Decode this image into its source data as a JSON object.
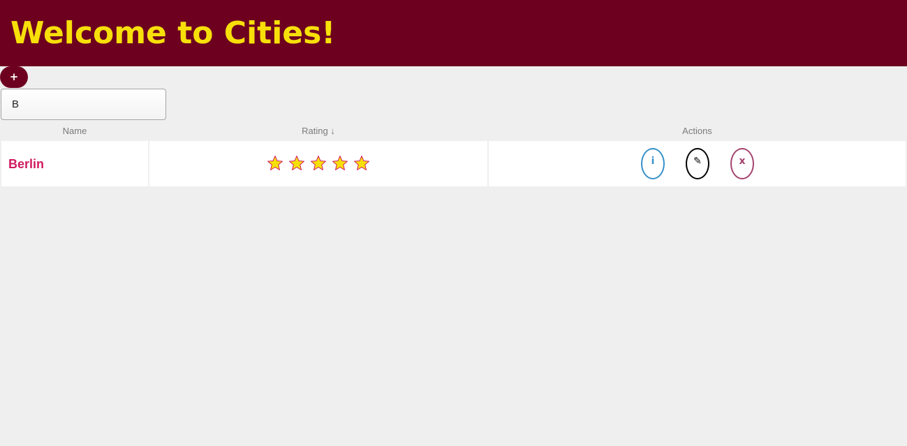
{
  "header": {
    "title": "Welcome to Cities!"
  },
  "toolbar": {
    "add_label": "+"
  },
  "search": {
    "value": "B",
    "placeholder": ""
  },
  "table": {
    "columns": [
      "Name",
      "Rating ↓",
      "Actions"
    ],
    "rows": [
      {
        "name": "Berlin",
        "rating": 5,
        "rating_max": 5,
        "actions": {
          "info_label": "i",
          "edit_label": "✎",
          "delete_label": "x"
        }
      }
    ]
  },
  "colors": {
    "header_bg": "#6e001f",
    "title": "#f7e00a",
    "city_link": "#d11a5e",
    "star_fill": "#f7e00a",
    "star_stroke": "#d11a5e",
    "info": "#3590c9",
    "edit": "#000000",
    "delete": "#a5426e",
    "page_bg": "#efefef"
  },
  "icons": {
    "add": "plus-icon",
    "rating": "star-icon",
    "info": "info-icon",
    "edit": "pencil-icon",
    "delete": "close-icon"
  }
}
